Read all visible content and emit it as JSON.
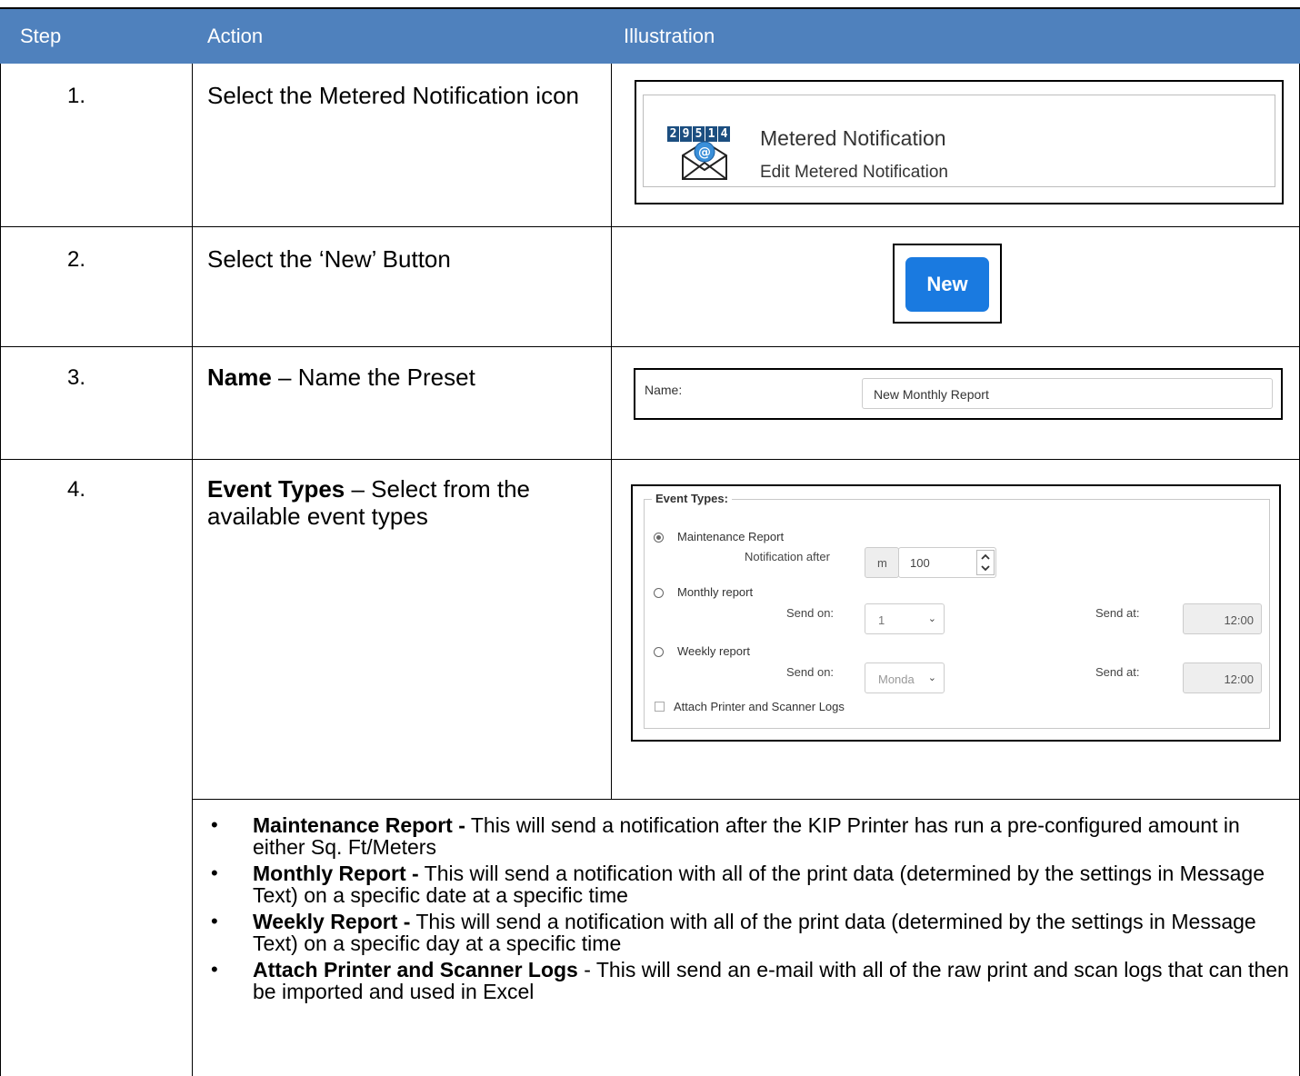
{
  "header": {
    "step": "Step",
    "action": "Action",
    "illustration": "Illustration"
  },
  "header_color": "#4f81bd",
  "rows": [
    {
      "step": "1.",
      "action_text": "Select the Metered Notification icon"
    },
    {
      "step": "2.",
      "action_text": "Select the ‘New’ Button"
    },
    {
      "step": "3.",
      "action_bold": "Name",
      "action_rest": " – Name the Preset"
    },
    {
      "step": "4.",
      "action_bold": "Event Types",
      "action_rest": " – Select from the available event types"
    }
  ],
  "illustration1": {
    "counter_digits": [
      "2",
      "9",
      "5",
      "1",
      "4"
    ],
    "title": "Metered Notification",
    "subtitle": "Edit Metered Notification",
    "icon": "envelope-at-icon"
  },
  "illustration2": {
    "button_label": "New",
    "button_color": "#1a7ae0"
  },
  "illustration3": {
    "label": "Name:",
    "value": "New Monthly Report"
  },
  "illustration4": {
    "legend": "Event Types:",
    "maintenance": {
      "label": "Maintenance Report",
      "selected": true,
      "notify_label": "Notification after",
      "unit": "m",
      "value": "100"
    },
    "monthly": {
      "label": "Monthly report",
      "send_on_label": "Send on:",
      "send_on_value": "1",
      "send_at_label": "Send at:",
      "send_at_value": "12:00"
    },
    "weekly": {
      "label": "Weekly report",
      "send_on_label": "Send on:",
      "send_on_value": "Monda",
      "send_at_label": "Send at:",
      "send_at_value": "12:00"
    },
    "attach_logs": {
      "label": "Attach Printer and Scanner Logs",
      "checked": false
    }
  },
  "bullets": [
    {
      "bold": "Maintenance Report -",
      "text": " This will send a notification after the KIP Printer has run a pre-configured amount in either Sq. Ft/Meters"
    },
    {
      "bold": "Monthly Report -",
      "text": " This will send a notification with all of the print data (determined by the settings in Message Text) on a specific date at a specific time"
    },
    {
      "bold": "Weekly Report -",
      "text": " This will send a notification with all of the print data (determined by the settings in Message Text) on a specific day at a specific time"
    },
    {
      "bold": "Attach Printer and Scanner Logs",
      "text": " - This will send an e-mail with all of the raw print and scan logs that can then be imported and used in Excel"
    }
  ]
}
